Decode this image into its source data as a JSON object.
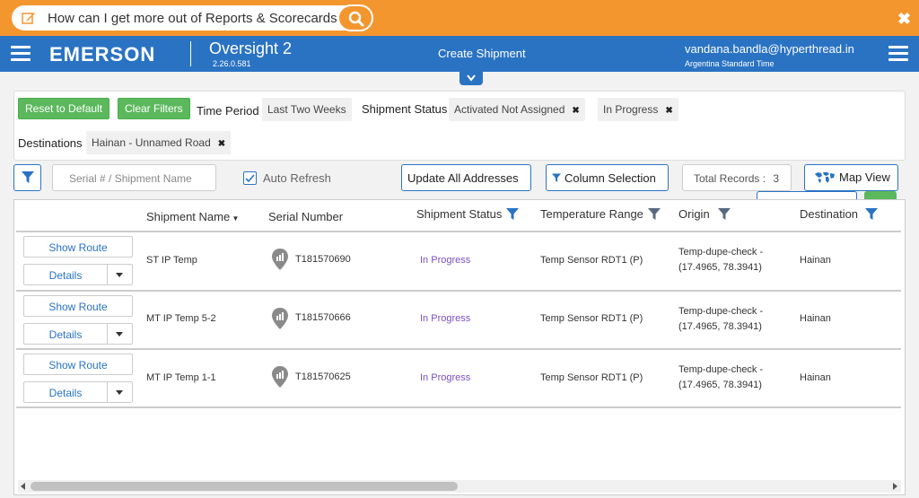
{
  "banner": {
    "search_text": "How can I get more out of Reports & Scorecards?"
  },
  "header": {
    "brand": "EMERSON",
    "app_name": "Oversight 2",
    "version": "2.26.0.581",
    "page_title": "Create Shipment",
    "user_email": "vandana.bandla@hyperthread.in",
    "timezone": "Argentina Standard Time"
  },
  "filters": {
    "reset_label": "Reset to Default",
    "clear_label": "Clear Filters",
    "time_period_label": "Time Period",
    "time_period_value": "Last Two Weeks",
    "shipment_status_label": "Shipment Status",
    "status_chips": [
      "Activated Not Assigned",
      "In Progress"
    ],
    "destinations_label": "Destinations",
    "destination_chip": "Hainan - Unnamed Road"
  },
  "toolbar": {
    "search_placeholder": "Serial # / Shipment Name",
    "auto_refresh_label": "Auto Refresh",
    "auto_refresh_checked": true,
    "update_all_label": "Update All Addresses",
    "column_selection_label": "Column Selection",
    "total_records_label": "Total Records :",
    "total_records_value": "3",
    "map_view_label": "Map View"
  },
  "table": {
    "columns": [
      "Shipment Name",
      "Serial Number",
      "Shipment Status",
      "Temperature Range",
      "Origin",
      "Destination"
    ],
    "show_route_label": "Show Route",
    "details_label": "Details",
    "rows": [
      {
        "name": "ST IP Temp",
        "serial": "T181570690",
        "status": "In Progress",
        "temp": "Temp Sensor RDT1 (P)",
        "origin_line1": "Temp-dupe-check -",
        "origin_line2": "(17.4965, 78.3941)",
        "destination": "Hainan"
      },
      {
        "name": "MT IP Temp 5-2",
        "serial": "T181570666",
        "status": "In Progress",
        "temp": "Temp Sensor RDT1 (P)",
        "origin_line1": "Temp-dupe-check -",
        "origin_line2": "(17.4965, 78.3941)",
        "destination": "Hainan"
      },
      {
        "name": "MT IP Temp 1-1",
        "serial": "T181570625",
        "status": "In Progress",
        "temp": "Temp Sensor RDT1 (P)",
        "origin_line1": "Temp-dupe-check -",
        "origin_line2": "(17.4965, 78.3941)",
        "destination": "Hainan"
      }
    ]
  },
  "colors": {
    "banner": "#f4962e",
    "header": "#2a73c3",
    "green": "#5cb85c",
    "status_purple": "#7a4fc2"
  }
}
